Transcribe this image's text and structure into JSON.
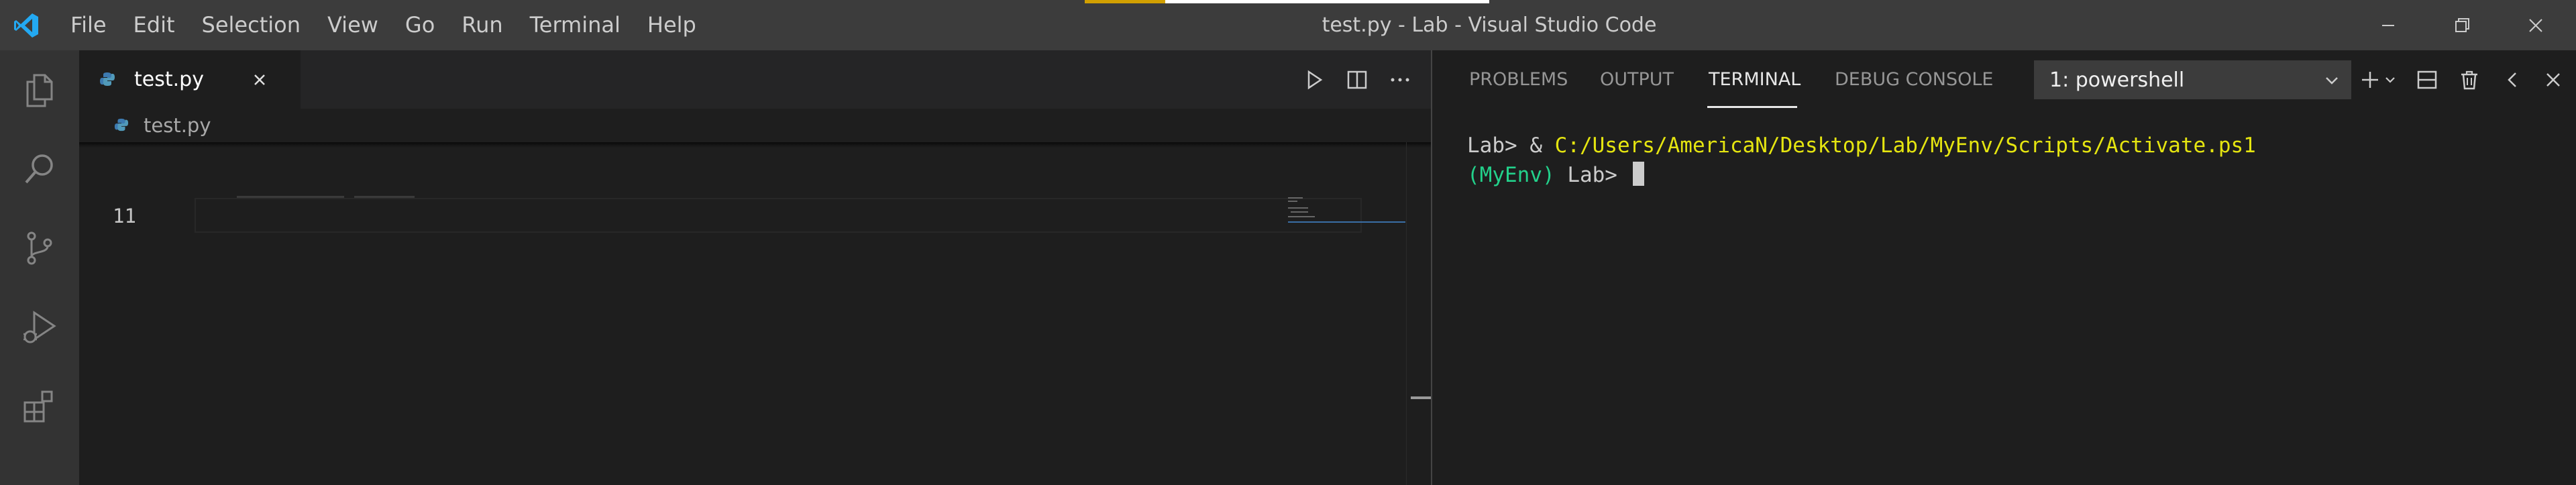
{
  "titlebar": {
    "menu": [
      "File",
      "Edit",
      "Selection",
      "View",
      "Go",
      "Run",
      "Terminal",
      "Help"
    ],
    "title": "test.py - Lab - Visual Studio Code",
    "controls": [
      "minimize",
      "restore",
      "close"
    ]
  },
  "activitybar": {
    "items": [
      "explorer",
      "search",
      "source-control",
      "run-and-debug",
      "extensions"
    ]
  },
  "editor": {
    "tab": {
      "label": "test.py",
      "icon": "python-file-icon"
    },
    "actions": [
      "run-python-file",
      "split-editor",
      "more-actions"
    ],
    "breadcrumb": "test.py",
    "line_number": "11"
  },
  "panel": {
    "tabs": [
      "PROBLEMS",
      "OUTPUT",
      "TERMINAL",
      "DEBUG CONSOLE"
    ],
    "active_tab": "TERMINAL",
    "terminal_select": "1: powershell",
    "actions": [
      "new-terminal",
      "split-terminal",
      "kill-terminal",
      "maximize-panel",
      "close-panel"
    ],
    "terminal": {
      "line1_prompt": "Lab> & ",
      "line1_command": "C:/Users/AmericaN/Desktop/Lab/MyEnv/Scripts/Activate.ps1",
      "line2_env": "(MyEnv)",
      "line2_prompt": " Lab> "
    }
  },
  "colors": {
    "titlebar_bg": "#3c3c3c",
    "activitybar_bg": "#333333",
    "editor_bg": "#1e1e1e",
    "tab_inactive_bg": "#252526",
    "accent_yellow": "#e5e510",
    "accent_green": "#23d18b",
    "vscode_blue": "#23a9f2"
  }
}
